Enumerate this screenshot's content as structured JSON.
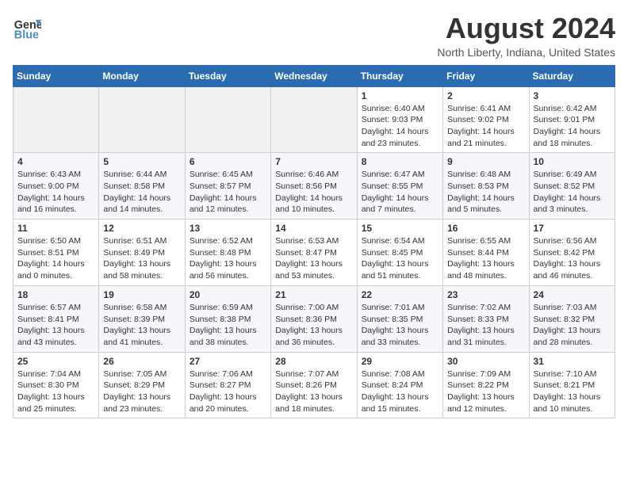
{
  "header": {
    "logo_general": "General",
    "logo_blue": "Blue",
    "month_title": "August 2024",
    "location": "North Liberty, Indiana, United States"
  },
  "weekdays": [
    "Sunday",
    "Monday",
    "Tuesday",
    "Wednesday",
    "Thursday",
    "Friday",
    "Saturday"
  ],
  "weeks": [
    [
      {
        "day": "",
        "info": ""
      },
      {
        "day": "",
        "info": ""
      },
      {
        "day": "",
        "info": ""
      },
      {
        "day": "",
        "info": ""
      },
      {
        "day": "1",
        "info": "Sunrise: 6:40 AM\nSunset: 9:03 PM\nDaylight: 14 hours\nand 23 minutes."
      },
      {
        "day": "2",
        "info": "Sunrise: 6:41 AM\nSunset: 9:02 PM\nDaylight: 14 hours\nand 21 minutes."
      },
      {
        "day": "3",
        "info": "Sunrise: 6:42 AM\nSunset: 9:01 PM\nDaylight: 14 hours\nand 18 minutes."
      }
    ],
    [
      {
        "day": "4",
        "info": "Sunrise: 6:43 AM\nSunset: 9:00 PM\nDaylight: 14 hours\nand 16 minutes."
      },
      {
        "day": "5",
        "info": "Sunrise: 6:44 AM\nSunset: 8:58 PM\nDaylight: 14 hours\nand 14 minutes."
      },
      {
        "day": "6",
        "info": "Sunrise: 6:45 AM\nSunset: 8:57 PM\nDaylight: 14 hours\nand 12 minutes."
      },
      {
        "day": "7",
        "info": "Sunrise: 6:46 AM\nSunset: 8:56 PM\nDaylight: 14 hours\nand 10 minutes."
      },
      {
        "day": "8",
        "info": "Sunrise: 6:47 AM\nSunset: 8:55 PM\nDaylight: 14 hours\nand 7 minutes."
      },
      {
        "day": "9",
        "info": "Sunrise: 6:48 AM\nSunset: 8:53 PM\nDaylight: 14 hours\nand 5 minutes."
      },
      {
        "day": "10",
        "info": "Sunrise: 6:49 AM\nSunset: 8:52 PM\nDaylight: 14 hours\nand 3 minutes."
      }
    ],
    [
      {
        "day": "11",
        "info": "Sunrise: 6:50 AM\nSunset: 8:51 PM\nDaylight: 14 hours\nand 0 minutes."
      },
      {
        "day": "12",
        "info": "Sunrise: 6:51 AM\nSunset: 8:49 PM\nDaylight: 13 hours\nand 58 minutes."
      },
      {
        "day": "13",
        "info": "Sunrise: 6:52 AM\nSunset: 8:48 PM\nDaylight: 13 hours\nand 56 minutes."
      },
      {
        "day": "14",
        "info": "Sunrise: 6:53 AM\nSunset: 8:47 PM\nDaylight: 13 hours\nand 53 minutes."
      },
      {
        "day": "15",
        "info": "Sunrise: 6:54 AM\nSunset: 8:45 PM\nDaylight: 13 hours\nand 51 minutes."
      },
      {
        "day": "16",
        "info": "Sunrise: 6:55 AM\nSunset: 8:44 PM\nDaylight: 13 hours\nand 48 minutes."
      },
      {
        "day": "17",
        "info": "Sunrise: 6:56 AM\nSunset: 8:42 PM\nDaylight: 13 hours\nand 46 minutes."
      }
    ],
    [
      {
        "day": "18",
        "info": "Sunrise: 6:57 AM\nSunset: 8:41 PM\nDaylight: 13 hours\nand 43 minutes."
      },
      {
        "day": "19",
        "info": "Sunrise: 6:58 AM\nSunset: 8:39 PM\nDaylight: 13 hours\nand 41 minutes."
      },
      {
        "day": "20",
        "info": "Sunrise: 6:59 AM\nSunset: 8:38 PM\nDaylight: 13 hours\nand 38 minutes."
      },
      {
        "day": "21",
        "info": "Sunrise: 7:00 AM\nSunset: 8:36 PM\nDaylight: 13 hours\nand 36 minutes."
      },
      {
        "day": "22",
        "info": "Sunrise: 7:01 AM\nSunset: 8:35 PM\nDaylight: 13 hours\nand 33 minutes."
      },
      {
        "day": "23",
        "info": "Sunrise: 7:02 AM\nSunset: 8:33 PM\nDaylight: 13 hours\nand 31 minutes."
      },
      {
        "day": "24",
        "info": "Sunrise: 7:03 AM\nSunset: 8:32 PM\nDaylight: 13 hours\nand 28 minutes."
      }
    ],
    [
      {
        "day": "25",
        "info": "Sunrise: 7:04 AM\nSunset: 8:30 PM\nDaylight: 13 hours\nand 25 minutes."
      },
      {
        "day": "26",
        "info": "Sunrise: 7:05 AM\nSunset: 8:29 PM\nDaylight: 13 hours\nand 23 minutes."
      },
      {
        "day": "27",
        "info": "Sunrise: 7:06 AM\nSunset: 8:27 PM\nDaylight: 13 hours\nand 20 minutes."
      },
      {
        "day": "28",
        "info": "Sunrise: 7:07 AM\nSunset: 8:26 PM\nDaylight: 13 hours\nand 18 minutes."
      },
      {
        "day": "29",
        "info": "Sunrise: 7:08 AM\nSunset: 8:24 PM\nDaylight: 13 hours\nand 15 minutes."
      },
      {
        "day": "30",
        "info": "Sunrise: 7:09 AM\nSunset: 8:22 PM\nDaylight: 13 hours\nand 12 minutes."
      },
      {
        "day": "31",
        "info": "Sunrise: 7:10 AM\nSunset: 8:21 PM\nDaylight: 13 hours\nand 10 minutes."
      }
    ]
  ]
}
